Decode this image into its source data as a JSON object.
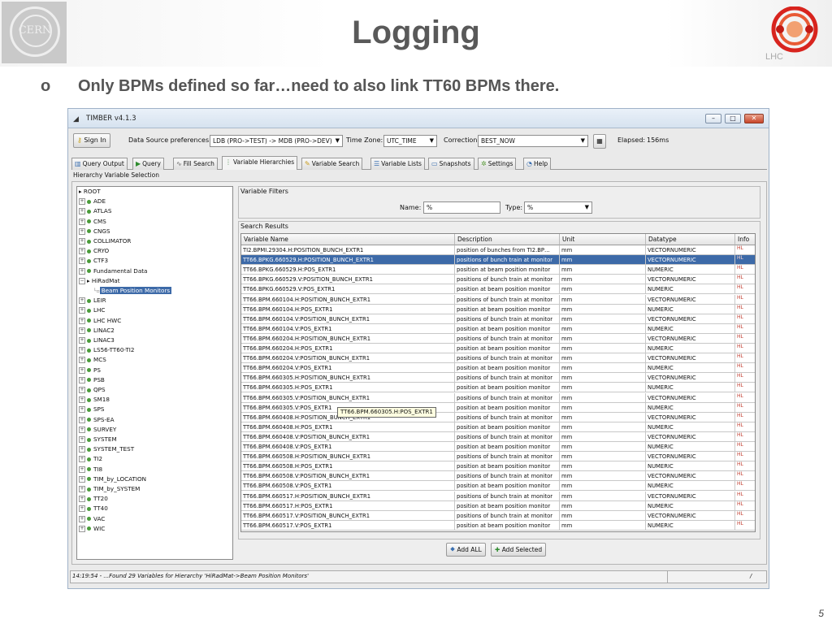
{
  "slide": {
    "title": "Logging",
    "bullet_mark": "o",
    "bullet": "Only BPMs defined so far…need to also link TT60 BPMs there.",
    "page_number": "5",
    "cern_logo_text": "CERN",
    "lhc_logo_text": "LHC"
  },
  "window": {
    "title": "TIMBER v4.1.3",
    "minimize": "–",
    "maximize": "□",
    "close": "✕"
  },
  "toolbar": {
    "sign_in": "Sign In",
    "data_source_label": "Data Source preferences:",
    "data_source_value": "LDB (PRO->TEST) -> MDB (PRO->DEV)",
    "time_zone_label": "Time Zone:",
    "time_zone_value": "UTC_TIME",
    "correction_label": "Correction",
    "correction_value": "BEST_NOW",
    "elapsed_label": "Elapsed:",
    "elapsed_value": "156ms"
  },
  "tabs": [
    {
      "label": "Query Output",
      "icon": "chart-icon"
    },
    {
      "label": "Query",
      "icon": "play-icon"
    },
    {
      "label": "Fill Search",
      "icon": "wave-icon"
    },
    {
      "label": "Variable Hierarchies",
      "icon": "hierarchy-icon",
      "active": true
    },
    {
      "label": "Variable Search",
      "icon": "pencil-icon"
    },
    {
      "label": "Variable Lists",
      "icon": "list-icon"
    },
    {
      "label": "Snapshots",
      "icon": "camera-icon"
    },
    {
      "label": "Settings",
      "icon": "gear-icon"
    },
    {
      "label": "Help",
      "icon": "help-icon"
    }
  ],
  "panel_caption": "Hierarchy Variable Selection",
  "tree": {
    "root": "ROOT",
    "items": [
      "ADE",
      "ATLAS",
      "CMS",
      "CNGS",
      "COLLIMATOR",
      "CRYO",
      "CTF3",
      "Fundamental Data",
      "HiRadMat"
    ],
    "selected_child": "Beam Position Monitors",
    "items_after": [
      "LEIR",
      "LHC",
      "LHC HWC",
      "LINAC2",
      "LINAC3",
      "LS56-TT60-TI2",
      "MCS",
      "PS",
      "PSB",
      "QPS",
      "SM18",
      "SPS",
      "SPS-EA",
      "SURVEY",
      "SYSTEM",
      "SYSTEM_TEST",
      "TI2",
      "TI8",
      "TIM_by_LOCATION",
      "TIM_by_SYSTEM",
      "TT20",
      "TT40",
      "VAC",
      "WIC"
    ]
  },
  "filters": {
    "caption": "Variable Filters",
    "name_label": "Name:",
    "name_value": "%",
    "type_label": "Type:",
    "type_value": "%"
  },
  "results": {
    "caption": "Search Results",
    "columns": [
      "Variable Name",
      "Description",
      "Unit",
      "Datatype",
      "Info"
    ],
    "selected_index": 1,
    "rows": [
      [
        "TI2.BPMI.29304.H:POSITION_BUNCH_EXTR1",
        "position of bunches from TI2.BP…",
        "mm",
        "VECTORNUMERIC",
        "HL"
      ],
      [
        "TT66.BPKG.660529.H:POSITION_BUNCH_EXTR1",
        "positions of bunch train at monitor",
        "mm",
        "VECTORNUMERIC",
        "HL"
      ],
      [
        "TT66.BPKG.660529.H:POS_EXTR1",
        "position at beam position monitor",
        "mm",
        "NUMERIC",
        "HL"
      ],
      [
        "TT66.BPKG.660529.V:POSITION_BUNCH_EXTR1",
        "positions of bunch train at monitor",
        "mm",
        "VECTORNUMERIC",
        "HL"
      ],
      [
        "TT66.BPKG.660529.V:POS_EXTR1",
        "position at beam position monitor",
        "mm",
        "NUMERIC",
        "HL"
      ],
      [
        "TT66.BPM.660104.H:POSITION_BUNCH_EXTR1",
        "positions of bunch train at monitor",
        "mm",
        "VECTORNUMERIC",
        "HL"
      ],
      [
        "TT66.BPM.660104.H:POS_EXTR1",
        "position at beam position monitor",
        "mm",
        "NUMERIC",
        "HL"
      ],
      [
        "TT66.BPM.660104.V:POSITION_BUNCH_EXTR1",
        "positions of bunch train at monitor",
        "mm",
        "VECTORNUMERIC",
        "HL"
      ],
      [
        "TT66.BPM.660104.V:POS_EXTR1",
        "position at beam position monitor",
        "mm",
        "NUMERIC",
        "HL"
      ],
      [
        "TT66.BPM.660204.H:POSITION_BUNCH_EXTR1",
        "positions of bunch train at monitor",
        "mm",
        "VECTORNUMERIC",
        "HL"
      ],
      [
        "TT66.BPM.660204.H:POS_EXTR1",
        "position at beam position monitor",
        "mm",
        "NUMERIC",
        "HL"
      ],
      [
        "TT66.BPM.660204.V:POSITION_BUNCH_EXTR1",
        "positions of bunch train at monitor",
        "mm",
        "VECTORNUMERIC",
        "HL"
      ],
      [
        "TT66.BPM.660204.V:POS_EXTR1",
        "position at beam position monitor",
        "mm",
        "NUMERIC",
        "HL"
      ],
      [
        "TT66.BPM.660305.H:POSITION_BUNCH_EXTR1",
        "positions of bunch train at monitor",
        "mm",
        "VECTORNUMERIC",
        "HL"
      ],
      [
        "TT66.BPM.660305.H:POS_EXTR1",
        "position at beam position monitor",
        "mm",
        "NUMERIC",
        "HL"
      ],
      [
        "TT66.BPM.660305.V:POSITION_BUNCH_EXTR1",
        "positions of bunch train at monitor",
        "mm",
        "VECTORNUMERIC",
        "HL"
      ],
      [
        "TT66.BPM.660305.V:POS_EXTR1",
        "position at beam position monitor",
        "mm",
        "NUMERIC",
        "HL"
      ],
      [
        "TT66.BPM.660408.H:POSITION_BUNCH_EXTR1",
        "positions of bunch train at monitor",
        "mm",
        "VECTORNUMERIC",
        "HL"
      ],
      [
        "TT66.BPM.660408.H:POS_EXTR1",
        "position at beam position monitor",
        "mm",
        "NUMERIC",
        "HL"
      ],
      [
        "TT66.BPM.660408.V:POSITION_BUNCH_EXTR1",
        "positions of bunch train at monitor",
        "mm",
        "VECTORNUMERIC",
        "HL"
      ],
      [
        "TT66.BPM.660408.V:POS_EXTR1",
        "position at beam position monitor",
        "mm",
        "NUMERIC",
        "HL"
      ],
      [
        "TT66.BPM.660508.H:POSITION_BUNCH_EXTR1",
        "positions of bunch train at monitor",
        "mm",
        "VECTORNUMERIC",
        "HL"
      ],
      [
        "TT66.BPM.660508.H:POS_EXTR1",
        "position at beam position monitor",
        "mm",
        "NUMERIC",
        "HL"
      ],
      [
        "TT66.BPM.660508.V:POSITION_BUNCH_EXTR1",
        "positions of bunch train at monitor",
        "mm",
        "VECTORNUMERIC",
        "HL"
      ],
      [
        "TT66.BPM.660508.V:POS_EXTR1",
        "position at beam position monitor",
        "mm",
        "NUMERIC",
        "HL"
      ],
      [
        "TT66.BPM.660517.H:POSITION_BUNCH_EXTR1",
        "positions of bunch train at monitor",
        "mm",
        "VECTORNUMERIC",
        "HL"
      ],
      [
        "TT66.BPM.660517.H:POS_EXTR1",
        "position at beam position monitor",
        "mm",
        "NUMERIC",
        "HL"
      ],
      [
        "TT66.BPM.660517.V:POSITION_BUNCH_EXTR1",
        "positions of bunch train at monitor",
        "mm",
        "VECTORNUMERIC",
        "HL"
      ],
      [
        "TT66.BPM.660517.V:POS_EXTR1",
        "position at beam position monitor",
        "mm",
        "NUMERIC",
        "HL"
      ]
    ],
    "tooltip": "TT66.BPM.660305.H:POS_EXTR1"
  },
  "actions": {
    "add_all": "Add ALL",
    "add_selected": "Add Selected"
  },
  "status": {
    "message": "14:19:54 - ...Found 29 Variables for Hierarchy 'HiRadMat->Beam Position Monitors'",
    "right": "/"
  }
}
